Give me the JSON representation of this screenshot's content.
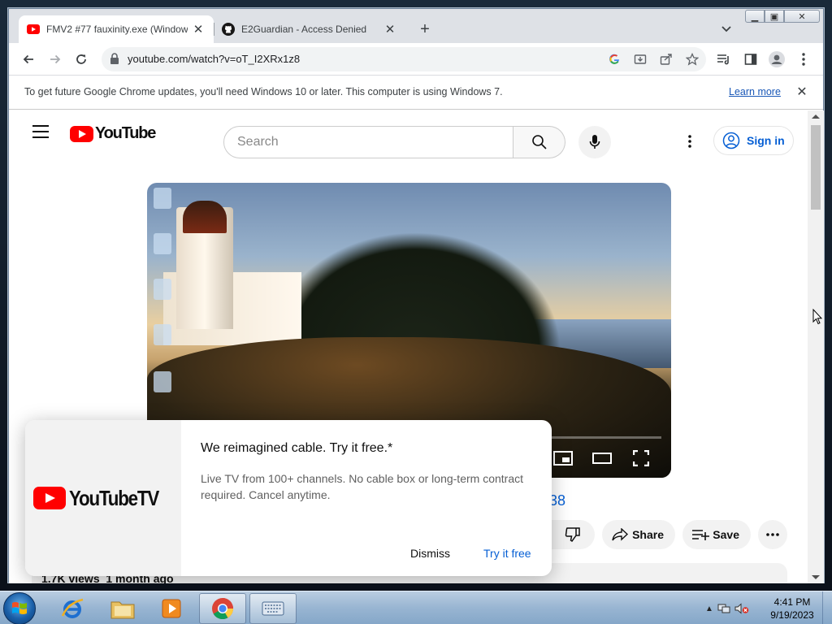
{
  "browser": {
    "tabs": [
      {
        "title": "FMV2 #77 fauxinity.exe (Window",
        "favicon": "youtube-icon",
        "active": true
      },
      {
        "title": "E2Guardian - Access Denied",
        "favicon": "github-icon",
        "active": false
      }
    ],
    "url": "youtube.com/watch?v=oT_I2XRx1z8",
    "infobar": {
      "message": "To get future Google Chrome updates, you'll need Windows 10 or later. This computer is using Windows 7.",
      "link": "Learn more"
    }
  },
  "youtube": {
    "logo_text": "YouTube",
    "search_placeholder": "Search",
    "sign_in": "Sign in",
    "title_fragment": "38",
    "actions": {
      "share": "Share",
      "save": "Save"
    },
    "views_line": "1.7K views  1 month ago"
  },
  "popup": {
    "logo_text": "YouTubeTV",
    "heading": "We reimagined cable. Try it free.*",
    "body": "Live TV from 100+ channels. No cable box or long-term contract required. Cancel anytime.",
    "dismiss": "Dismiss",
    "try": "Try it free"
  },
  "taskbar": {
    "apps": [
      "internet-explorer-icon",
      "file-explorer-icon",
      "media-player-icon",
      "chrome-icon",
      "keyboard-icon"
    ],
    "time": "4:41 PM",
    "date": "9/19/2023"
  },
  "colors": {
    "youtube_red": "#ff0000",
    "link_blue": "#065fd4",
    "chrome_link": "#1a58b7"
  }
}
